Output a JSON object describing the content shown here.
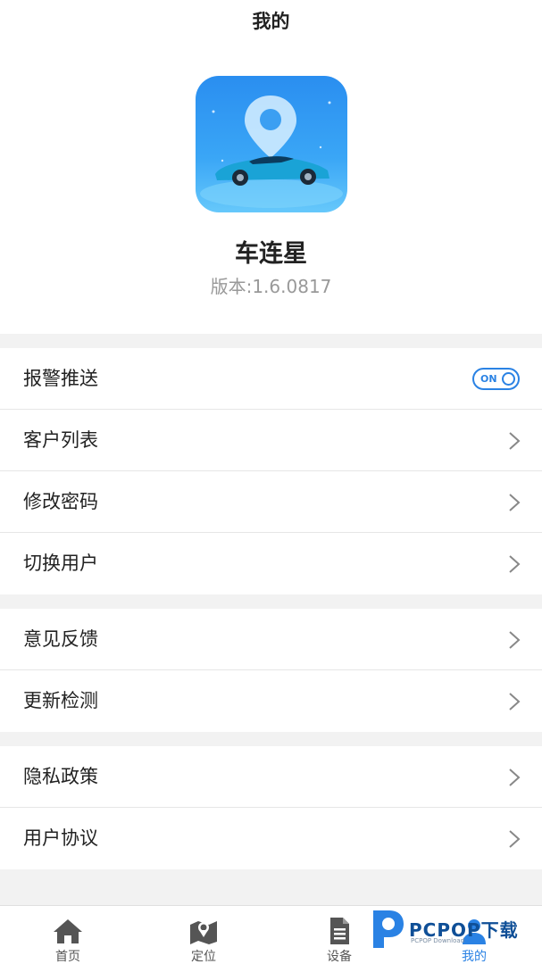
{
  "header": {
    "title": "我的"
  },
  "app": {
    "name": "车连星",
    "version": "版本:1.6.0817"
  },
  "settings": {
    "group1": [
      {
        "label": "报警推送",
        "toggle": {
          "state": "ON",
          "on": true
        }
      },
      {
        "label": "客户列表"
      },
      {
        "label": "修改密码"
      },
      {
        "label": "切换用户"
      }
    ],
    "group2": [
      {
        "label": "意见反馈"
      },
      {
        "label": "更新检测"
      }
    ],
    "group3": [
      {
        "label": "隐私政策"
      },
      {
        "label": "用户协议"
      }
    ]
  },
  "tabbar": {
    "items": [
      {
        "label": "首页",
        "icon": "home-icon"
      },
      {
        "label": "定位",
        "icon": "map-icon"
      },
      {
        "label": "设备",
        "icon": "document-icon"
      },
      {
        "label": "我的",
        "icon": "user-icon",
        "active": true
      }
    ]
  },
  "colors": {
    "accent": "#2a82e4",
    "background": "#f2f2f2",
    "text": "#222222",
    "muted": "#999999"
  },
  "watermark": {
    "text": "PCPOP下载",
    "subtext": "PCPOP Download"
  }
}
